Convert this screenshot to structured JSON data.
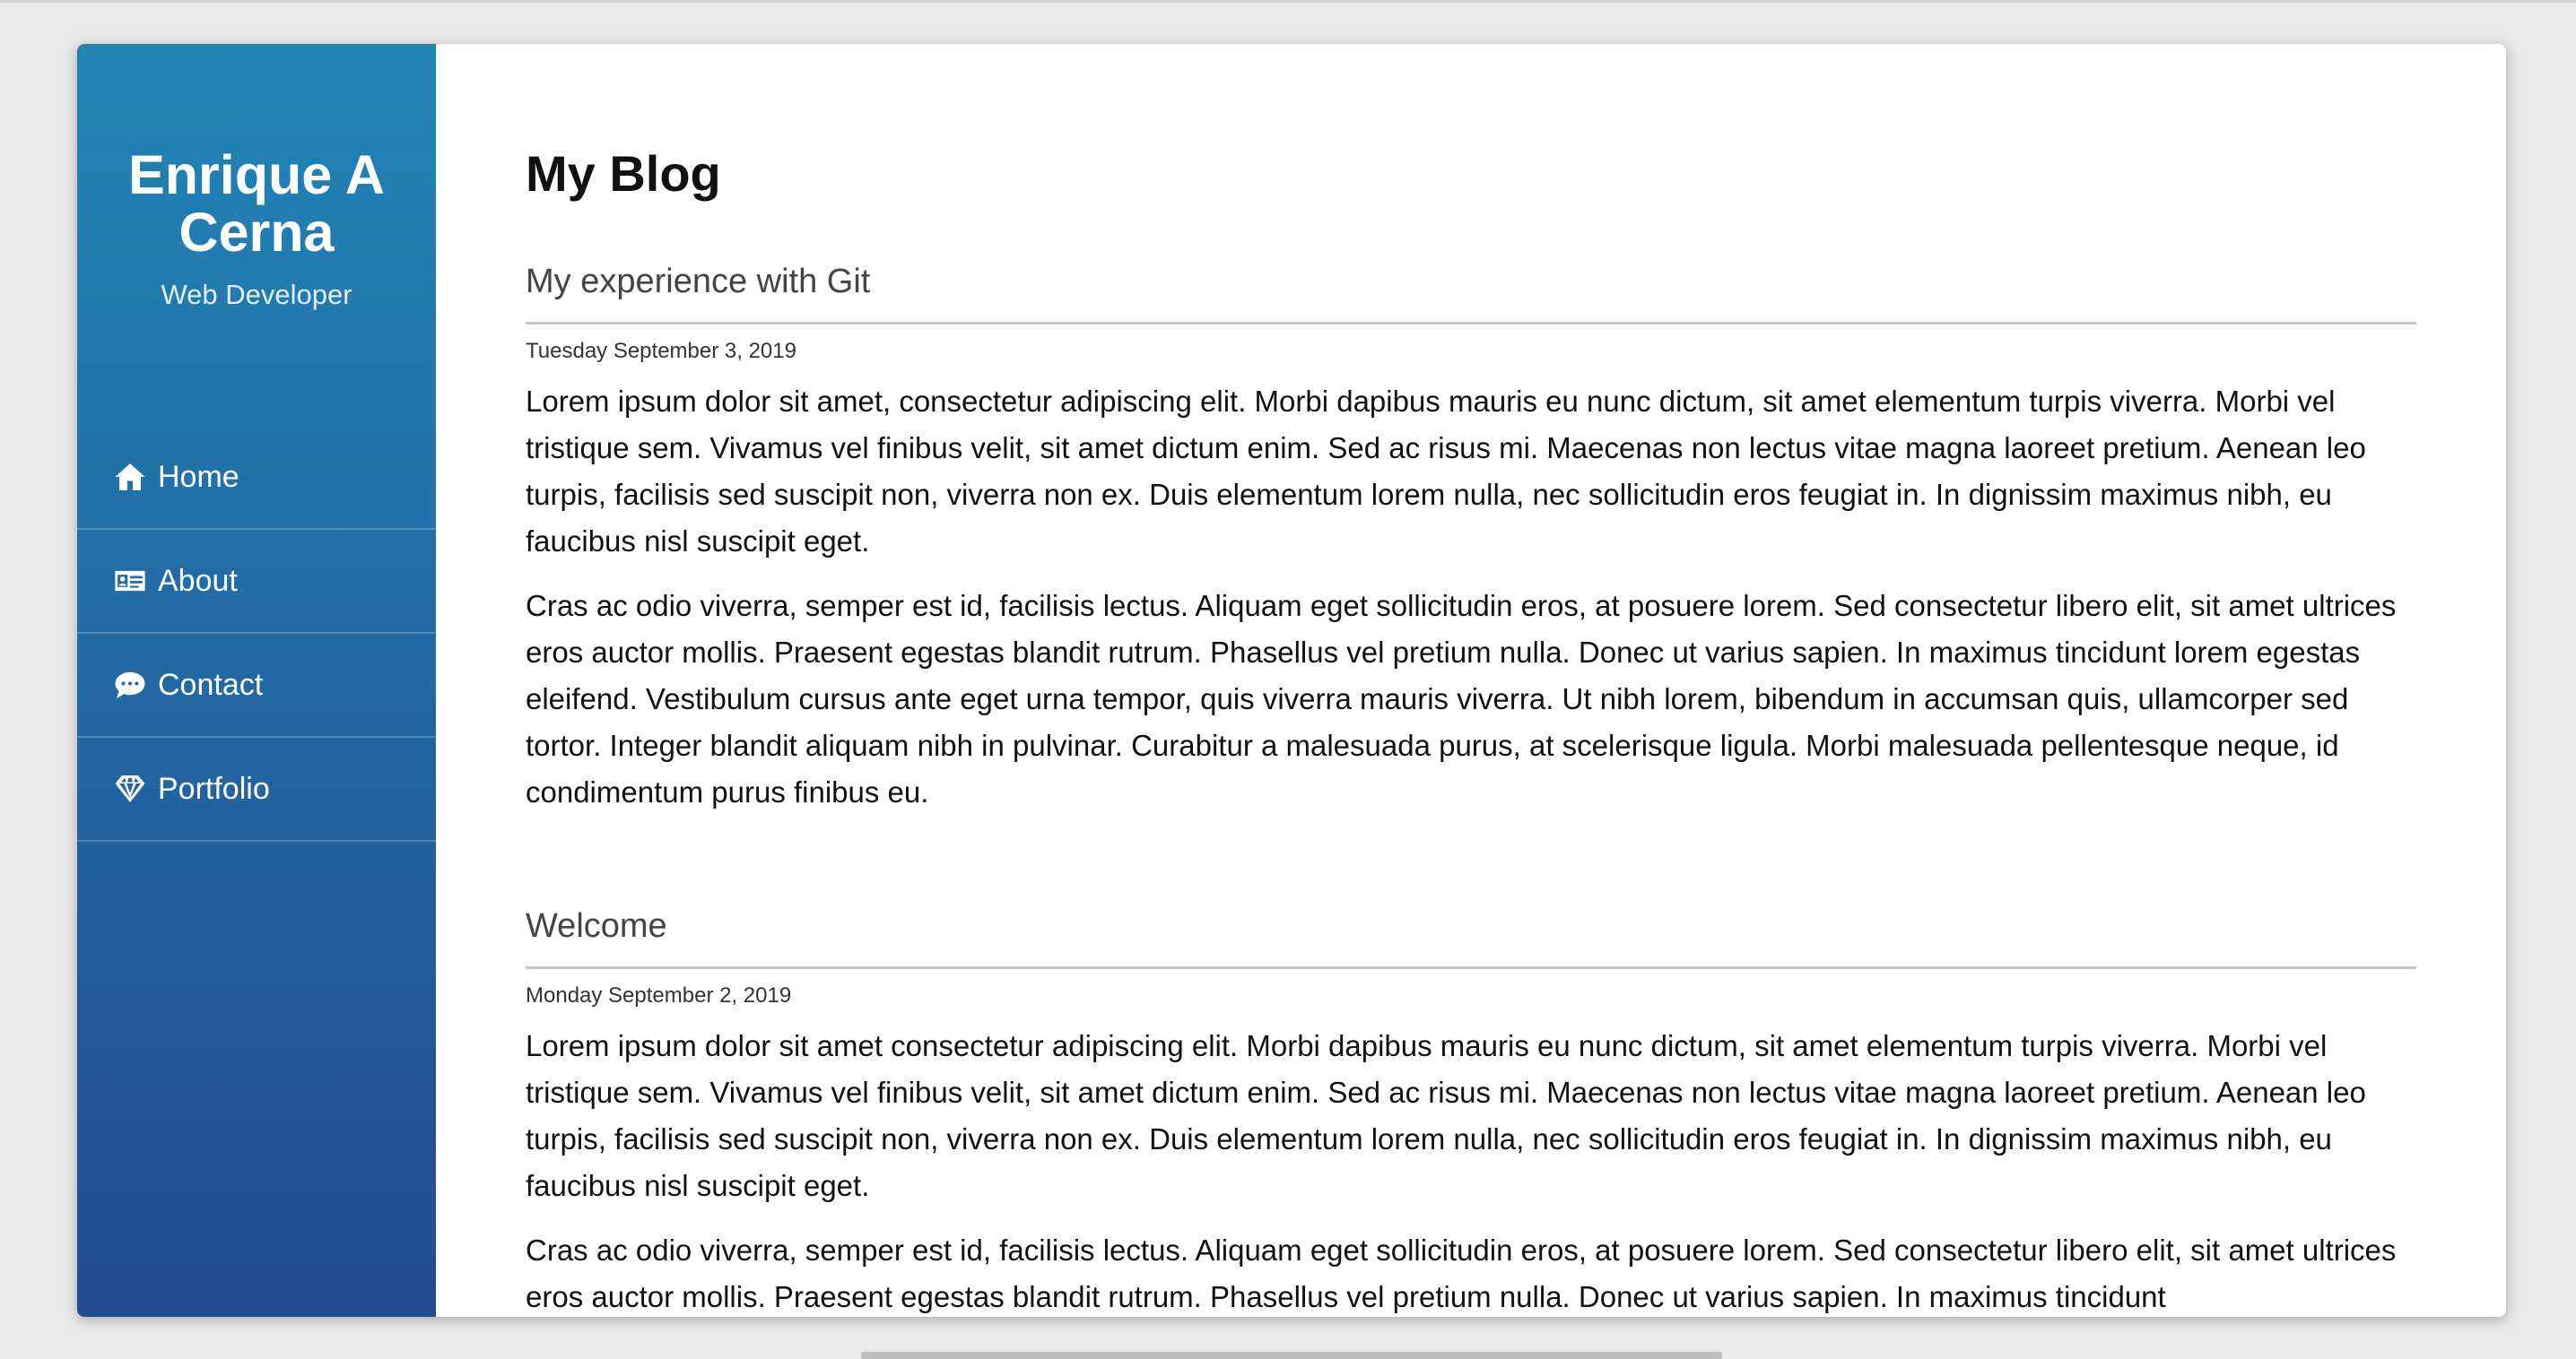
{
  "sidebar": {
    "name": "Enrique A Cerna",
    "subtitle": "Web Developer",
    "nav": [
      {
        "label": "Home",
        "icon": "home-icon"
      },
      {
        "label": "About",
        "icon": "id-card-icon"
      },
      {
        "label": "Contact",
        "icon": "chat-icon"
      },
      {
        "label": "Portfolio",
        "icon": "diamond-icon"
      }
    ],
    "gradient_top": "#2185b6",
    "gradient_bottom": "#244b93"
  },
  "main": {
    "title": "My Blog",
    "posts": [
      {
        "title": "My experience with Git",
        "date": "Tuesday September 3, 2019",
        "paragraphs": [
          "Lorem ipsum dolor sit amet, consectetur adipiscing elit. Morbi dapibus mauris eu nunc dictum, sit amet elementum turpis viverra. Morbi vel tristique sem. Vivamus vel finibus velit, sit amet dictum enim. Sed ac risus mi. Maecenas non lectus vitae magna laoreet pretium. Aenean leo turpis, facilisis sed suscipit non, viverra non ex. Duis elementum lorem nulla, nec sollicitudin eros feugiat in. In dignissim maximus nibh, eu faucibus nisl suscipit eget.",
          "Cras ac odio viverra, semper est id, facilisis lectus. Aliquam eget sollicitudin eros, at posuere lorem. Sed consectetur libero elit, sit amet ultrices eros auctor mollis. Praesent egestas blandit rutrum. Phasellus vel pretium nulla. Donec ut varius sapien. In maximus tincidunt lorem egestas eleifend. Vestibulum cursus ante eget urna tempor, quis viverra mauris viverra. Ut nibh lorem, bibendum in accumsan quis, ullamcorper sed tortor. Integer blandit aliquam nibh in pulvinar. Curabitur a malesuada purus, at scelerisque ligula. Morbi malesuada pellentesque neque, id condimentum purus finibus eu."
        ]
      },
      {
        "title": "Welcome",
        "date": "Monday September 2, 2019",
        "paragraphs": [
          "Lorem ipsum dolor sit amet consectetur adipiscing elit. Morbi dapibus mauris eu nunc dictum, sit amet elementum turpis viverra. Morbi vel tristique sem. Vivamus vel finibus velit, sit amet dictum enim. Sed ac risus mi. Maecenas non lectus vitae magna laoreet pretium. Aenean leo turpis, facilisis sed suscipit non, viverra non ex. Duis elementum lorem nulla, nec sollicitudin eros feugiat in. In dignissim maximus nibh, eu faucibus nisl suscipit eget.",
          "Cras ac odio viverra, semper est id, facilisis lectus. Aliquam eget sollicitudin eros, at posuere lorem. Sed consectetur libero elit, sit amet ultrices eros auctor mollis. Praesent egestas blandit rutrum. Phasellus vel pretium nulla. Donec ut varius sapien. In maximus tincidunt"
        ]
      }
    ]
  }
}
